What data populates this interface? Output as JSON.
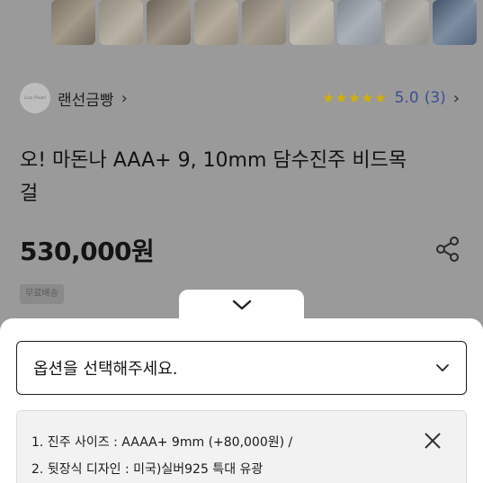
{
  "gallery": {
    "thumbnails": [
      {
        "name": "pearl-thumb-1"
      },
      {
        "name": "pearl-thumb-2"
      },
      {
        "name": "pearl-thumb-3"
      },
      {
        "name": "pearl-thumb-4"
      },
      {
        "name": "pearl-thumb-5"
      },
      {
        "name": "pearl-thumb-6"
      },
      {
        "name": "pearl-thumb-7"
      },
      {
        "name": "pearl-thumb-8"
      },
      {
        "name": "pearl-thumb-9"
      }
    ]
  },
  "shop": {
    "avatar_text": "Lux Pearl",
    "name": "랜선금빵",
    "chevron": "›",
    "stars": "★★★★★",
    "rating": "5.0",
    "review_count": "(3)",
    "rating_chevron": "›"
  },
  "product": {
    "title": "오! 마돈나 AAA+ 9, 10mm 담수진주 비드목걸",
    "price": "530,000원",
    "shipping_badge": "무료배송"
  },
  "options": {
    "select_placeholder": "옵션을 선택해주세요.",
    "selected": {
      "line1": "1. 진주 사이즈 : AAAA+ 9mm  (+80,000원) /",
      "line2": "2. 뒷장식 디자인 : 미국)실버925 특대 유광"
    }
  },
  "colors": {
    "star": "#d4b100",
    "rating_text": "#3a4f92"
  }
}
